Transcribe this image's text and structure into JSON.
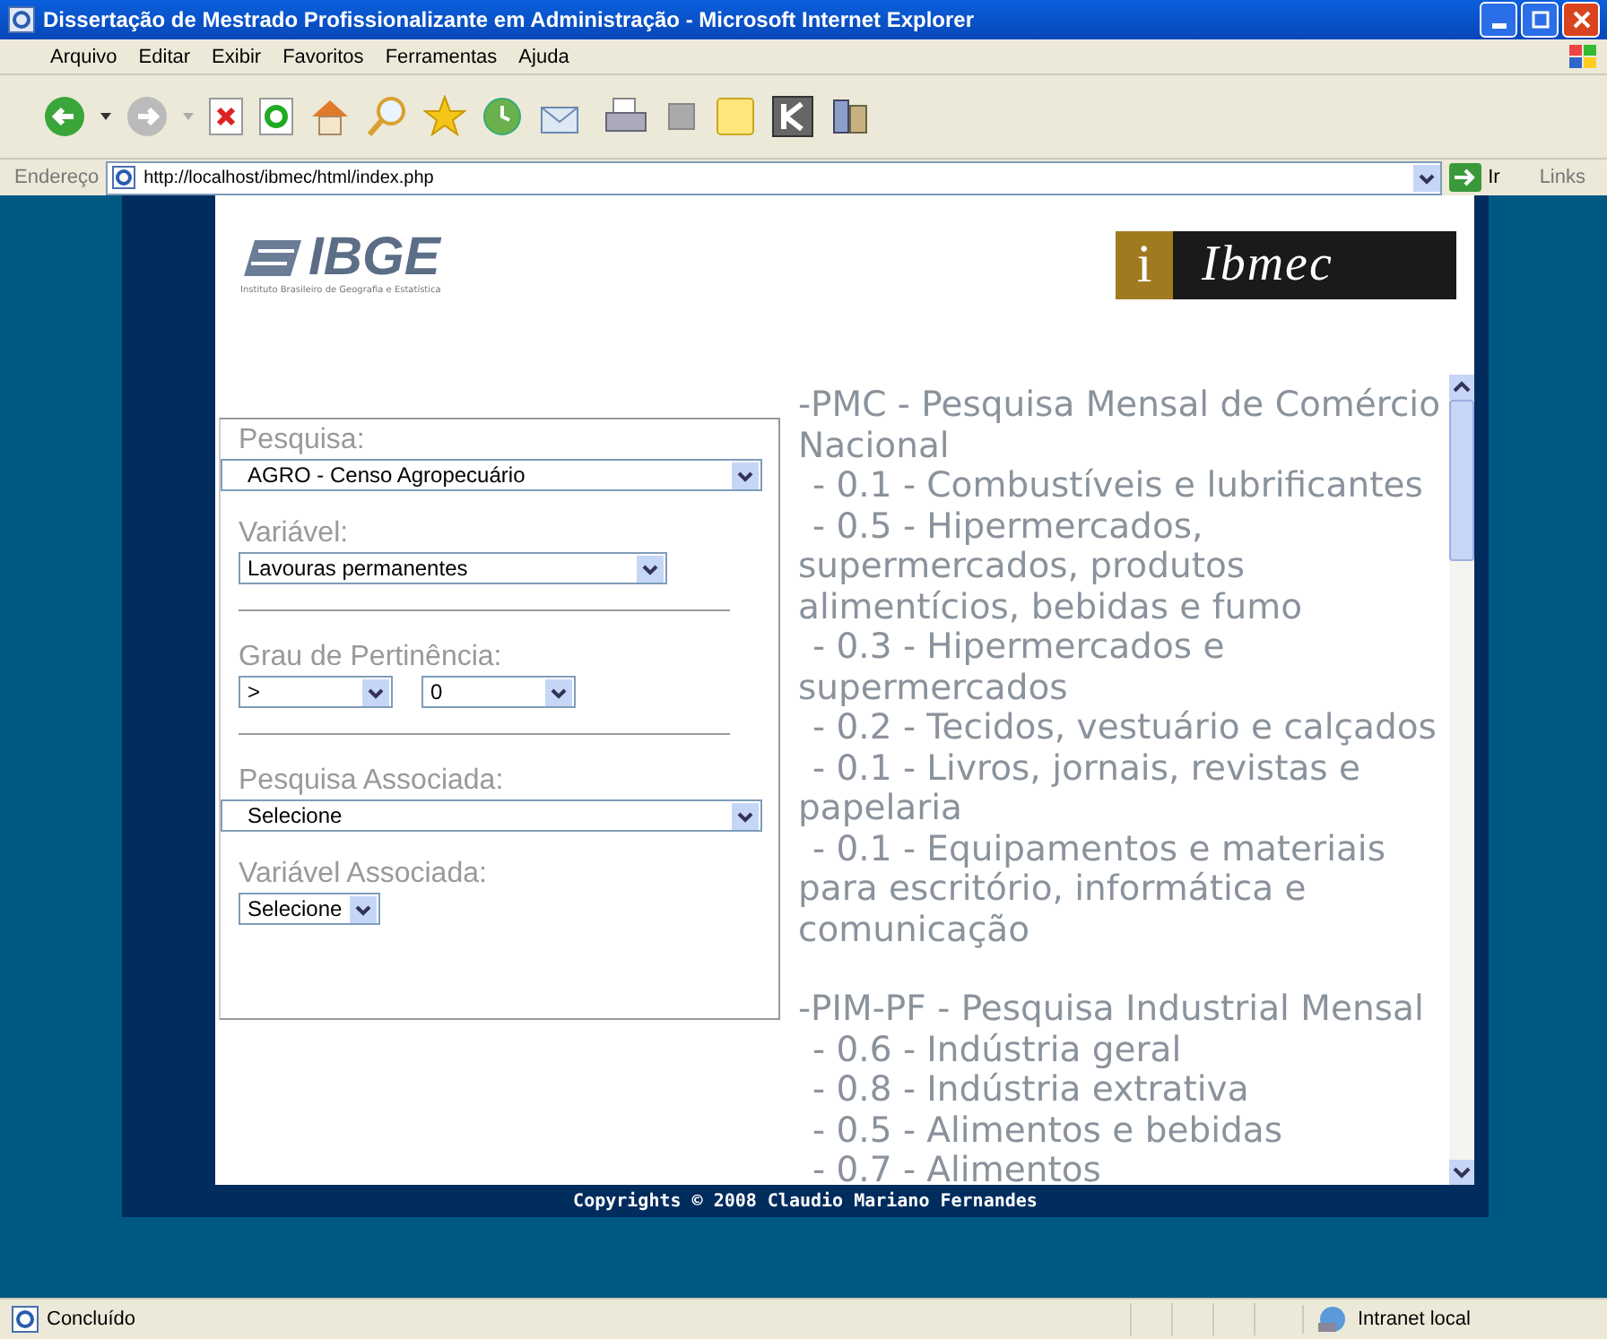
{
  "window": {
    "title": "Dissertação de Mestrado Profissionalizante em Administração - Microsoft Internet Explorer"
  },
  "menu": [
    "Arquivo",
    "Editar",
    "Exibir",
    "Favoritos",
    "Ferramentas",
    "Ajuda"
  ],
  "address": {
    "label": "Endereço",
    "url": "http://localhost/ibmec/html/index.php",
    "go": "Ir",
    "links": "Links"
  },
  "page": {
    "ibge_logo": {
      "name": "IBGE",
      "subtitle": "Instituto Brasileiro de Geografia e Estatística"
    },
    "ibmec_logo": {
      "letter": "i",
      "name": "Ibmec"
    },
    "form": {
      "groups": [
        {
          "fields": [
            {
              "label": "Pesquisa:",
              "selects": [
                {
                  "value": "AGRO - Censo Agropecuário"
                }
              ]
            },
            {
              "label": "Variável:",
              "selects": [
                {
                  "value": "Lavouras permanentes"
                }
              ]
            }
          ]
        },
        {
          "fields": [
            {
              "label": "Grau de Pertinência:",
              "selects": [
                {
                  "value": ">"
                },
                {
                  "value": "0"
                }
              ]
            }
          ]
        },
        {
          "fields": [
            {
              "label": "Pesquisa Associada:",
              "selects": [
                {
                  "value": "Selecione"
                }
              ]
            },
            {
              "label": "Variável Associada:",
              "selects": [
                {
                  "value": "Selecione"
                }
              ]
            }
          ]
        }
      ]
    },
    "results": [
      {
        "title": "-PMC - Pesquisa Mensal de Comércio Nacional",
        "items": [
          "- 0.1 - Combustíveis e lubrificantes",
          "- 0.5 - Hipermercados, supermercados, produtos alimentícios, bebidas e fumo",
          "- 0.3 - Hipermercados e supermercados",
          "- 0.2 - Tecidos, vestuário e calçados",
          "- 0.1 - Livros, jornais, revistas e papelaria",
          "- 0.1 - Equipamentos e materiais para escritório, informática e comunicação"
        ]
      },
      {
        "title": "-PIM-PF - Pesquisa Industrial Mensal",
        "items": [
          "- 0.6 - Indústria geral",
          "- 0.8 - Indústria extrativa",
          "- 0.5 - Alimentos e bebidas",
          "- 0.7 - Alimentos"
        ]
      }
    ],
    "copyright": "Copyrights © 2008 Claudio Mariano Fernandes"
  },
  "status_bar": {
    "text": "Concluído",
    "zone": "Intranet local"
  }
}
